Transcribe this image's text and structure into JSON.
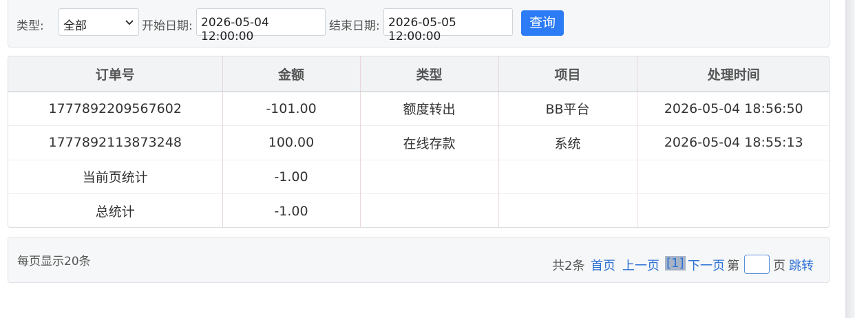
{
  "filter": {
    "type_label": "类型:",
    "type_value": "全部",
    "start_label": "开始日期:",
    "start_value": "2026-05-04 12:00:00",
    "end_label": "结束日期:",
    "end_value": "2026-05-05 12:00:00",
    "query_button": "查询"
  },
  "table": {
    "headers": [
      "订单号",
      "金额",
      "类型",
      "项目",
      "处理时间"
    ],
    "rows": [
      [
        "1777892209567602",
        "-101.00",
        "额度转出",
        "BB平台",
        "2026-05-04 18:56:50"
      ],
      [
        "1777892113873248",
        "100.00",
        "在线存款",
        "系统",
        "2026-05-04 18:55:13"
      ],
      [
        "当前页统计",
        "-1.00",
        "",
        "",
        ""
      ],
      [
        "总统计",
        "-1.00",
        "",
        "",
        ""
      ]
    ]
  },
  "pagination": {
    "per_page_text": "每页显示20条",
    "total_text": "共2条",
    "first": "首页",
    "prev": "上一页",
    "current": "[1]",
    "next": "下一页",
    "page_prefix": "第",
    "page_suffix": "页",
    "jump": "跳转"
  }
}
